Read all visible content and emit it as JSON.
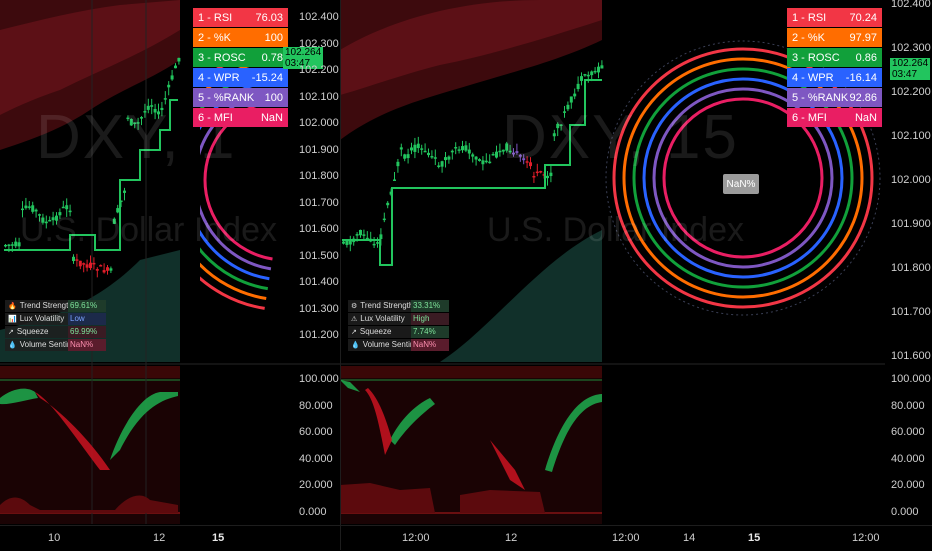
{
  "symbol_watermark_left": "DXY, 1",
  "symbol_watermark_right": "DXY, 15",
  "subtitle_watermark": "U.S. Dollar Index",
  "price_axis": [
    "102.400",
    "102.300",
    "102.200",
    "102.100",
    "102.000",
    "101.900",
    "101.800",
    "101.700",
    "101.600",
    "101.500",
    "101.400",
    "101.300",
    "101.200"
  ],
  "price_axis_right": [
    "102.400",
    "102.300",
    "102.200",
    "102.100",
    "102.000",
    "101.900",
    "101.800",
    "101.700",
    "101.600"
  ],
  "osc_axis": [
    "100.000",
    "80.000",
    "60.000",
    "40.000",
    "20.000",
    "0.000"
  ],
  "price_tag_left": {
    "price": "102.264",
    "timer": "03:47"
  },
  "price_tag_right": {
    "price": "102.264",
    "timer": "03:47"
  },
  "osc_table_left": [
    {
      "label": "1 - RSI",
      "value": "76.03",
      "color": "#f23645"
    },
    {
      "label": "2 - %K",
      "value": "100",
      "color": "#ff6d00"
    },
    {
      "label": "3 - ROSC",
      "value": "0.78",
      "color": "#11a03a"
    },
    {
      "label": "4 - WPR",
      "value": "-15.24",
      "color": "#2962ff"
    },
    {
      "label": "5 - %RANK",
      "value": "100",
      "color": "#7e57c2"
    },
    {
      "label": "6 - MFI",
      "value": "NaN",
      "color": "#e91e63"
    }
  ],
  "osc_table_right": [
    {
      "label": "1 - RSI",
      "value": "70.24",
      "color": "#f23645"
    },
    {
      "label": "2 - %K",
      "value": "97.97",
      "color": "#ff6d00"
    },
    {
      "label": "3 - ROSC",
      "value": "0.86",
      "color": "#11a03a"
    },
    {
      "label": "4 - WPR",
      "value": "-16.14",
      "color": "#2962ff"
    },
    {
      "label": "5 - %RANK",
      "value": "92.86",
      "color": "#7e57c2"
    },
    {
      "label": "6 - MFI",
      "value": "NaN",
      "color": "#e91e63"
    }
  ],
  "stats_left": [
    {
      "icon": "flame-icon",
      "glyph": "🔥",
      "name": "Trend Strength",
      "value": "69.61%",
      "bg": "#1e3b2a"
    },
    {
      "icon": "chart-icon",
      "glyph": "📊",
      "name": "Lux Volatility",
      "value": "Low",
      "bg": "#1c2a4a"
    },
    {
      "icon": "squeeze-icon",
      "glyph": "↗",
      "name": "Squeeze",
      "value": "69.99%",
      "bg": "#3a1b23"
    },
    {
      "icon": "droplet-icon",
      "glyph": "💧",
      "name": "Volume Sentiment",
      "value": "NaN%",
      "bg": "#5a1c2c"
    }
  ],
  "stats_right": [
    {
      "icon": "gear-icon",
      "glyph": "⚙",
      "name": "Trend Strength",
      "value": "33.31%",
      "bg": "#1e3b2a"
    },
    {
      "icon": "warning-icon",
      "glyph": "⚠",
      "name": "Lux Volatility",
      "value": "High",
      "bg": "#3a1b23"
    },
    {
      "icon": "squeeze-icon",
      "glyph": "↗",
      "name": "Squeeze",
      "value": "7.74%",
      "bg": "#1e3b2a"
    },
    {
      "icon": "droplet-icon",
      "glyph": "💧",
      "name": "Volume Sentiment",
      "value": "NaN%",
      "bg": "#5a1c2c"
    }
  ],
  "nan_label": "NaN%",
  "time_axis_left": [
    {
      "text": "10",
      "bold": false
    },
    {
      "text": "12",
      "bold": false
    },
    {
      "text": "15",
      "bold": true
    }
  ],
  "time_axis_right": [
    {
      "text": "12:00",
      "bold": false
    },
    {
      "text": "12",
      "bold": false
    },
    {
      "text": "12:00",
      "bold": false
    },
    {
      "text": "14",
      "bold": false
    },
    {
      "text": "15",
      "bold": true
    },
    {
      "text": "12:00",
      "bold": false
    }
  ],
  "colors": {
    "bull": "#22c55e",
    "bear": "#e11d2a",
    "band": "#5a0d12",
    "osc_bg": "#2a0506"
  }
}
